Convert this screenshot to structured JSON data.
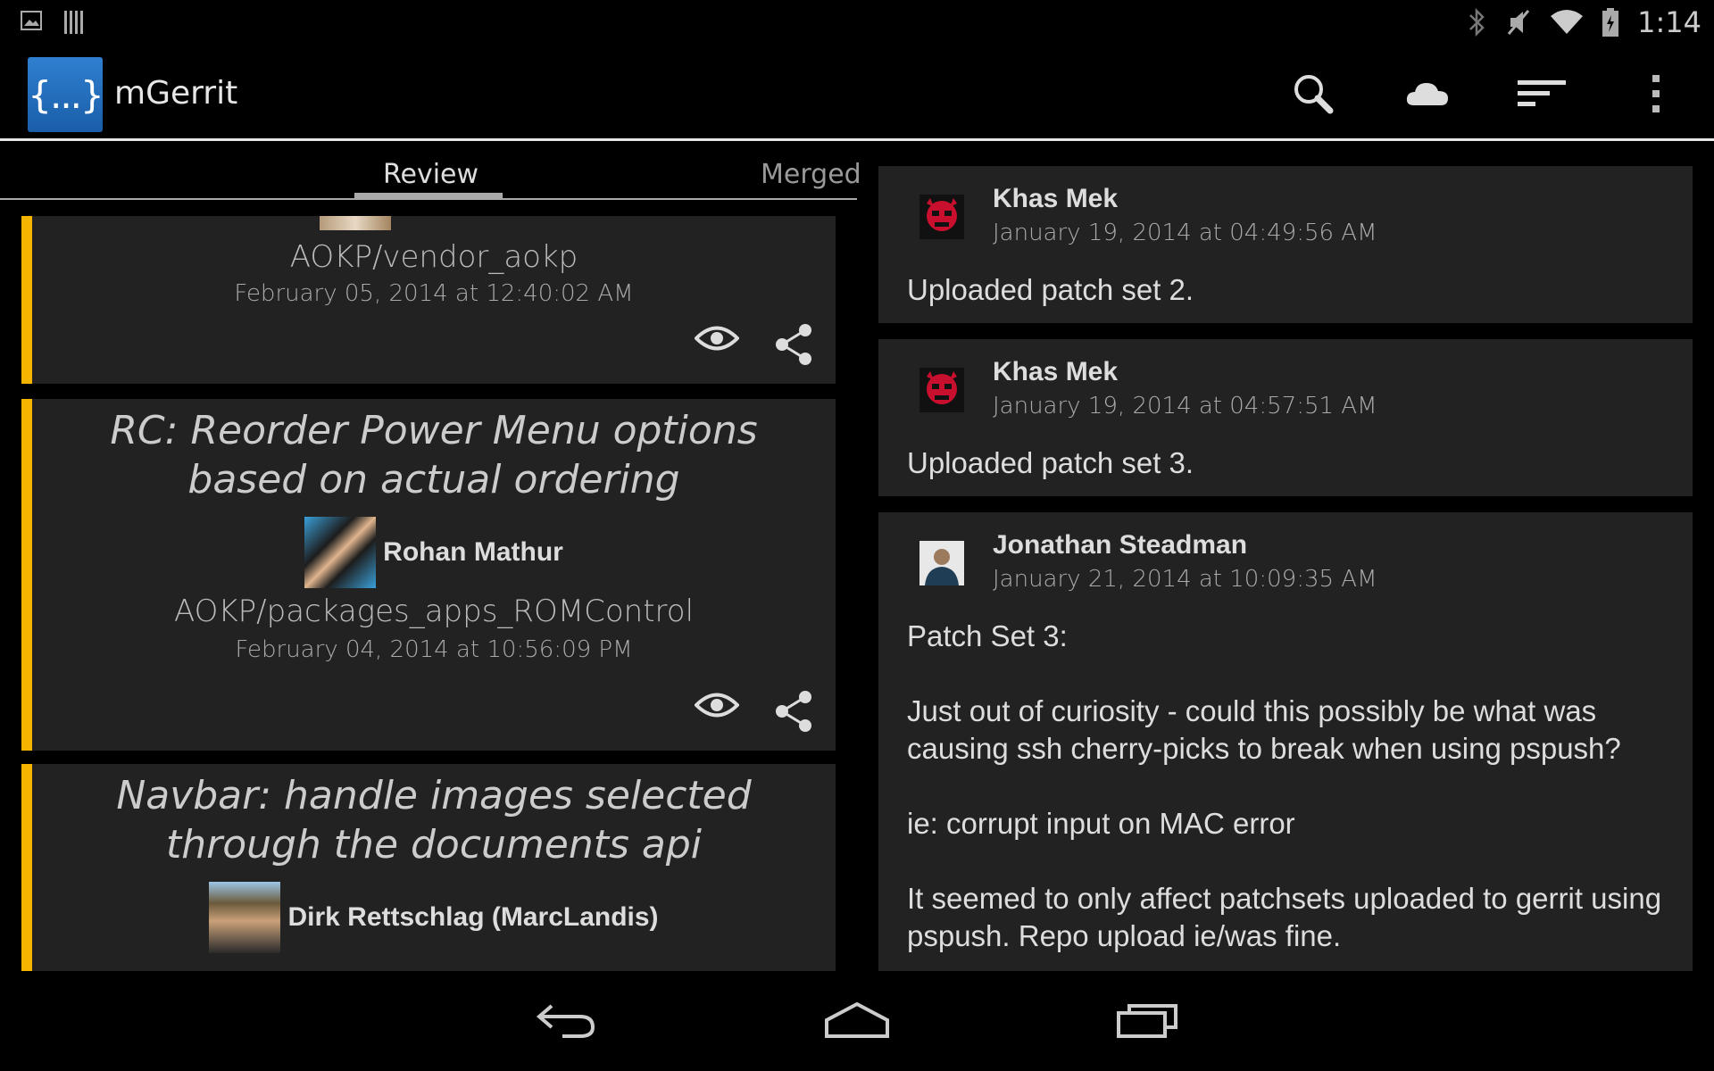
{
  "status_bar": {
    "time": "1:14",
    "icons": [
      "picture-icon",
      "barcode-icon",
      "bluetooth-icon",
      "mute-icon",
      "wifi-icon",
      "battery-icon"
    ]
  },
  "action_bar": {
    "logo_text": "{...}",
    "app_title": "mGerrit",
    "actions": [
      "search-icon",
      "cloud-icon",
      "sort-icon",
      "overflow-menu-icon"
    ]
  },
  "tabs": {
    "review_label": "Review",
    "merged_label": "Merged"
  },
  "changes": [
    {
      "title": "",
      "author": "",
      "project": "AOKP/vendor_aokp",
      "date": "February 05, 2014 at 12:40:02 AM"
    },
    {
      "title": "RC: Reorder Power Menu options based on actual ordering",
      "author": "Rohan Mathur",
      "project": "AOKP/packages_apps_ROMControl",
      "date": "February 04, 2014 at 10:56:09 PM"
    },
    {
      "title": "Navbar: handle images selected through the documents api",
      "author": "Dirk Rettschlag (MarcLandis)",
      "project": "",
      "date": ""
    }
  ],
  "comments": [
    {
      "author": "Khas Mek",
      "date": "January 19, 2014 at 04:49:56 AM",
      "body": "Uploaded patch set 2."
    },
    {
      "author": "Khas Mek",
      "date": "January 19, 2014 at 04:57:51 AM",
      "body": "Uploaded patch set 3."
    },
    {
      "author": "Jonathan Steadman",
      "date": "January 21, 2014 at 10:09:35 AM",
      "body": "Patch Set 3:\n\nJust out of curiosity - could this possibly be what was causing ssh cherry-picks to break when using pspush?\n\nie: corrupt input on MAC error\n\nIt seemed to only affect patchsets uploaded to gerrit using pspush. Repo upload ie/was fine."
    }
  ],
  "colors": {
    "accent": "#f4b400",
    "card_bg": "#222222",
    "logo_blue": "#2f7fd0"
  }
}
